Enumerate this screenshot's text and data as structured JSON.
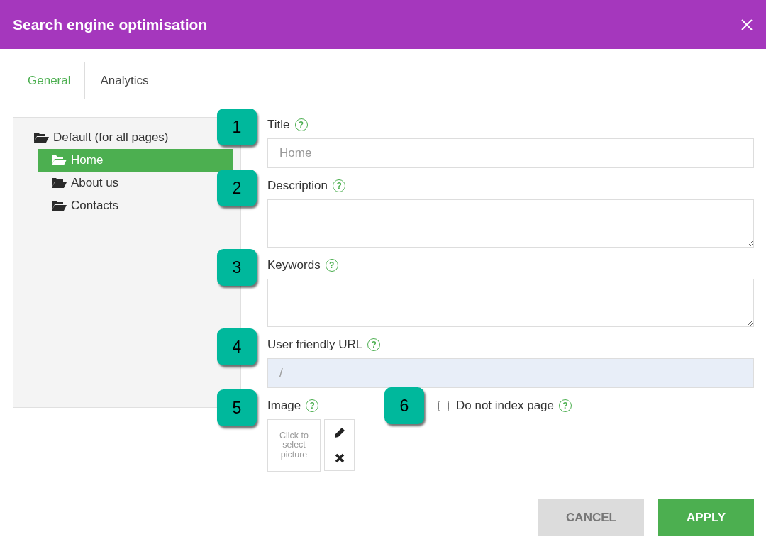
{
  "window": {
    "title": "Search engine optimisation"
  },
  "tabs": [
    {
      "label": "General",
      "selected": true
    },
    {
      "label": "Analytics",
      "selected": false
    }
  ],
  "tree": [
    {
      "label": "Default (for all pages)",
      "selected": false,
      "children": [
        {
          "label": "Home",
          "selected": true
        },
        {
          "label": "About us",
          "selected": false
        },
        {
          "label": "Contacts",
          "selected": false
        }
      ]
    }
  ],
  "fields": [
    {
      "kind": "text",
      "badge": "1",
      "label": "Title",
      "help": "?",
      "placeholder": "Home",
      "disabled": false
    },
    {
      "kind": "textarea",
      "badge": "2",
      "label": "Description",
      "help": "?"
    },
    {
      "kind": "textarea",
      "badge": "3",
      "label": "Keywords",
      "help": "?"
    },
    {
      "kind": "text",
      "badge": "4",
      "label": "User friendly URL",
      "help": "?",
      "placeholder": "/",
      "disabled": true
    }
  ],
  "image": {
    "badge": "5",
    "label": "Image",
    "help": "?",
    "hint": "Click to select picture"
  },
  "noindex": {
    "badge": "6",
    "label": "Do not index page",
    "help": "?",
    "checked": false
  },
  "buttons": [
    {
      "kind": "secondary",
      "label": "CANCEL"
    },
    {
      "kind": "primary",
      "label": "APPLY"
    }
  ]
}
